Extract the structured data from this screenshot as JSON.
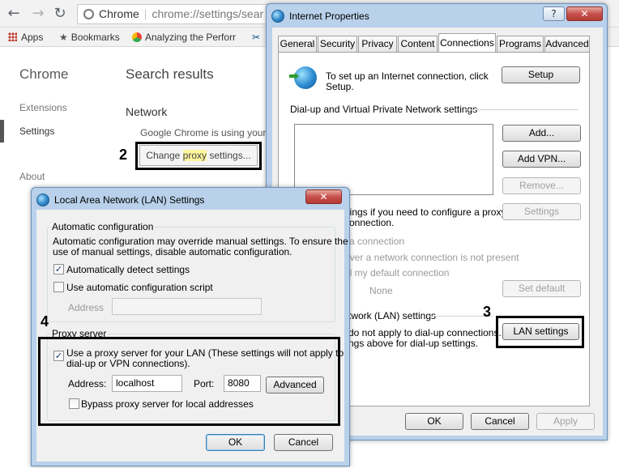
{
  "chrome": {
    "nav": {
      "back": "←",
      "forward": "→",
      "reload": "↻"
    },
    "omnibox": {
      "site": "Chrome",
      "url": "chrome://settings/sear"
    },
    "bookmarks": {
      "apps": "Apps",
      "bookmarks": "Bookmarks",
      "analyzing": "Analyzing the Perforr"
    },
    "sidebar": {
      "title": "Chrome",
      "extensions": "Extensions",
      "settings": "Settings",
      "about": "About"
    },
    "main": {
      "title": "Search results",
      "network_heading": "Network",
      "network_desc": "Google Chrome is using your",
      "proxy_btn_pre": "Change ",
      "proxy_btn_hl": "proxy",
      "proxy_btn_post": " settings..."
    }
  },
  "callouts": {
    "n2": "2",
    "n3": "3",
    "n4": "4"
  },
  "internet_properties": {
    "title": "Internet Properties",
    "help_glyph": "?",
    "close_glyph": "✕",
    "tabs": [
      "General",
      "Security",
      "Privacy",
      "Content",
      "Connections",
      "Programs",
      "Advanced"
    ],
    "setup_text_line1": "To set up an Internet connection, click",
    "setup_text_line2": "Setup.",
    "setup_btn": "Setup",
    "dialup_heading": "Dial-up and Virtual Private Network settings",
    "add_btn": "Add...",
    "add_vpn_btn": "Add VPN...",
    "remove_btn": "Remove...",
    "configure_line1": "ttings if you need to configure a proxy",
    "configure_line2": "connection.",
    "settings_btn": "Settings",
    "opt_never": "a connection",
    "opt_whenever": "ever a network connection is not present",
    "opt_always": "al my default connection",
    "current_none": "None",
    "set_default_btn": "Set default",
    "lan_heading": "twork (LAN) settings",
    "lan_line1": "do not apply to dial-up connections.",
    "lan_line2": "ngs above for dial-up settings.",
    "lan_settings_btn": "LAN settings",
    "ok": "OK",
    "cancel": "Cancel",
    "apply": "Apply"
  },
  "lan_dialog": {
    "title": "Local Area Network (LAN) Settings",
    "close_glyph": "✕",
    "auto_group": "Automatic configuration",
    "auto_desc_line1": "Automatic configuration may override manual settings.  To ensure the",
    "auto_desc_line2": "use of manual settings, disable automatic configuration.",
    "auto_detect": "Automatically detect settings",
    "auto_script": "Use automatic configuration script",
    "address_label": "Address",
    "proxy_group": "Proxy server",
    "use_proxy_line1": "Use a proxy server for your LAN (These settings will not apply to",
    "use_proxy_line2": "dial-up or VPN connections).",
    "proxy_address_label": "Address:",
    "proxy_address_value": "localhost",
    "port_label": "Port:",
    "port_value": "8080",
    "advanced_btn": "Advanced",
    "bypass_local": "Bypass proxy server for local addresses",
    "ok": "OK",
    "cancel": "Cancel",
    "check_glyph": "✓"
  }
}
